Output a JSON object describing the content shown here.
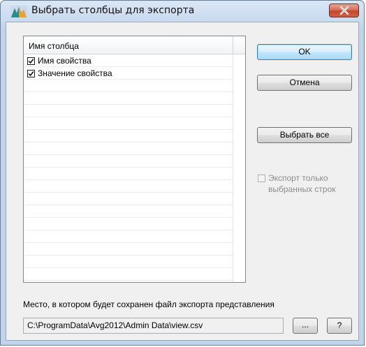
{
  "window": {
    "title": "Выбрать столбцы для экспорта"
  },
  "list": {
    "header": "Имя столбца",
    "items": [
      {
        "label": "Имя свойства",
        "checked": true
      },
      {
        "label": "Значение свойства",
        "checked": true
      }
    ]
  },
  "buttons": {
    "ok": "OK",
    "cancel": "Отмена",
    "select_all": "Выбрать все",
    "browse": "...",
    "help": "?"
  },
  "export_selected": {
    "label": "Экспорт только выбранных строк",
    "checked": false,
    "enabled": false
  },
  "path": {
    "caption": "Место, в котором будет сохранен файл экспорта представления",
    "value": "C:\\ProgramData\\Avg2012\\Admin Data\\view.csv"
  },
  "colors": {
    "title_bar": "#c9daef",
    "close_button": "#c3442c",
    "dialog_bg": "#f0f0f0"
  },
  "icons": {
    "app": "avg-logo-icon",
    "close": "close-icon",
    "check": "checkmark-icon"
  }
}
